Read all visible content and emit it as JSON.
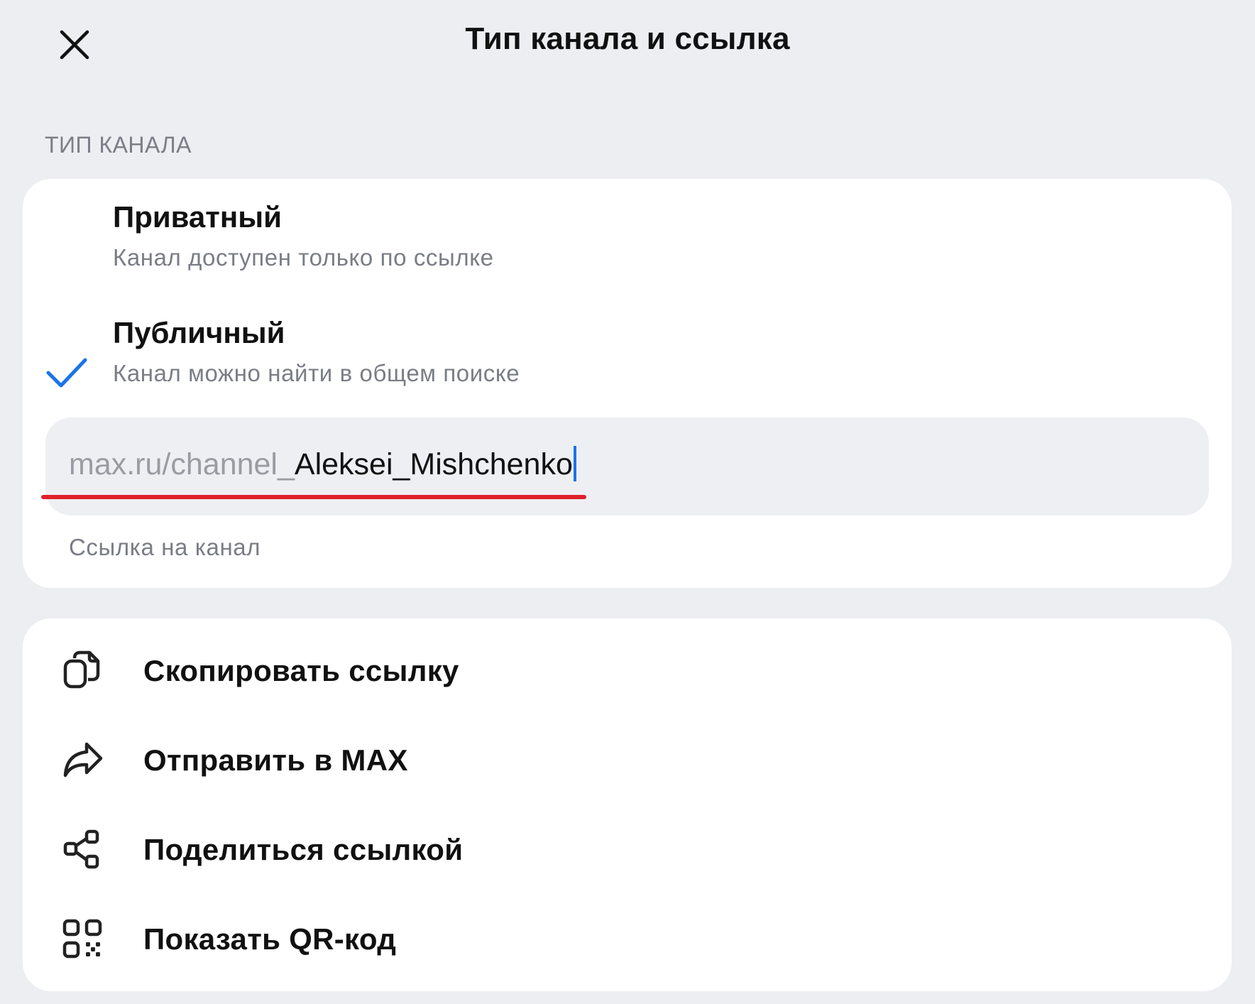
{
  "header": {
    "title": "Тип канала и ссылка",
    "close_icon": "close-icon"
  },
  "channel_type": {
    "section_label": "ТИП КАНАЛА",
    "options": [
      {
        "title": "Приватный",
        "subtitle": "Канал доступен только по ссылке",
        "selected": false
      },
      {
        "title": "Публичный",
        "subtitle": "Канал можно найти в общем поиске",
        "selected": true
      }
    ],
    "check_icon": "check-icon",
    "accent_color": "#1a73e8"
  },
  "link": {
    "prefix": "max.ru/channel_",
    "value": "Aleksei_Mishchenko",
    "caption": "Ссылка на канал",
    "underline_color": "#e0202a"
  },
  "actions": [
    {
      "label": "Скопировать ссылку",
      "icon": "copy-icon"
    },
    {
      "label": "Отправить в MAX",
      "icon": "forward-icon"
    },
    {
      "label": "Поделиться ссылкой",
      "icon": "share-icon"
    },
    {
      "label": "Показать QR-код",
      "icon": "qr-code-icon"
    }
  ]
}
